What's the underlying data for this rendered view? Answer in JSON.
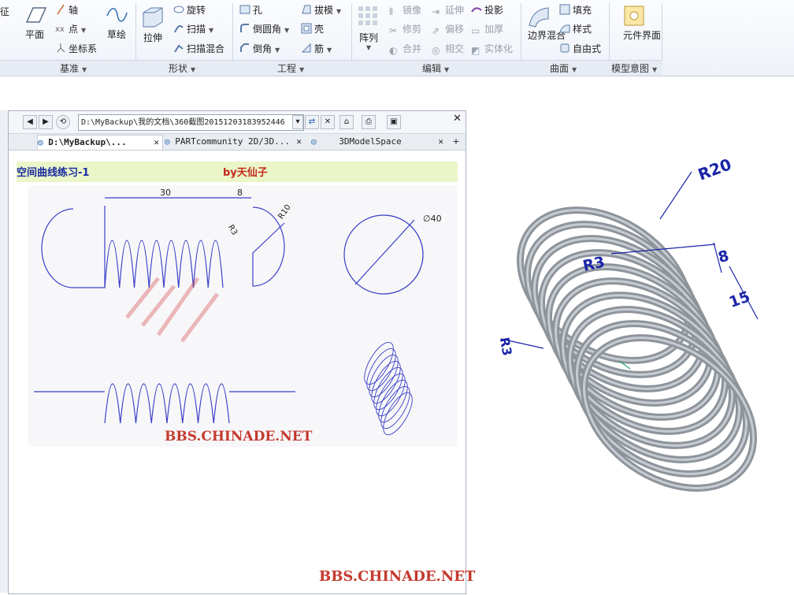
{
  "ribbon": {
    "cut_label": "征",
    "datum": {
      "plane": "平面",
      "axis": "轴",
      "point": "点",
      "csys": "坐标系",
      "sketch": "草绘"
    },
    "shape": {
      "extrude": "拉伸",
      "revolve": "旋转",
      "sweep": "扫描",
      "swept_blend": "扫描混合"
    },
    "engineering": {
      "hole": "孔",
      "round": "倒圆角",
      "chamfer": "倒角",
      "draft": "拔模",
      "shell": "壳",
      "rib": "筋"
    },
    "editing": {
      "pattern": "阵列",
      "mirror": "镜像",
      "trim": "修剪",
      "merge": "合并",
      "extend": "延伸",
      "offset": "偏移",
      "intersect": "相交",
      "project": "投影",
      "thicken": "加厚",
      "solidify": "实体化"
    },
    "surfaces": {
      "boundary_blend": "边界混合",
      "fill": "填充",
      "style": "样式",
      "freestyle": "自由式"
    },
    "model_intent": {
      "component_interface": "元件界面"
    },
    "groups": [
      "基准",
      "形状",
      "工程",
      "编辑",
      "曲面",
      "模型意图"
    ]
  },
  "browser": {
    "address": "D:\\MyBackup\\我的文档\\360截图20151203183952446",
    "tabs": [
      "D:\\MyBackup\\...",
      "PARTcommunity 2D/3D...",
      "3DModelSpace"
    ],
    "doc_title": "空间曲线练习-1",
    "doc_author": "by天仙子",
    "drawing": {
      "dim_30": "30",
      "dim_8": "8",
      "dim_r10": "R10",
      "dim_r3": "R3",
      "dim_d40": "∅40",
      "watermark": "BBS.CHINADE.NET"
    }
  },
  "model": {
    "r20": "R20",
    "r3_top": "R3",
    "dim_8": "8",
    "dim_15": "15",
    "r3_left": "R3"
  },
  "footer_watermark": "BBS.CHINADE.NET",
  "colors": {
    "accent_blue": "#1a25a8",
    "sketch_blue": "#3a3fc7",
    "spring_grey": "#8e949b",
    "watermark_red": "#c43a2e",
    "title_bar_green": "#eaf6c8"
  }
}
